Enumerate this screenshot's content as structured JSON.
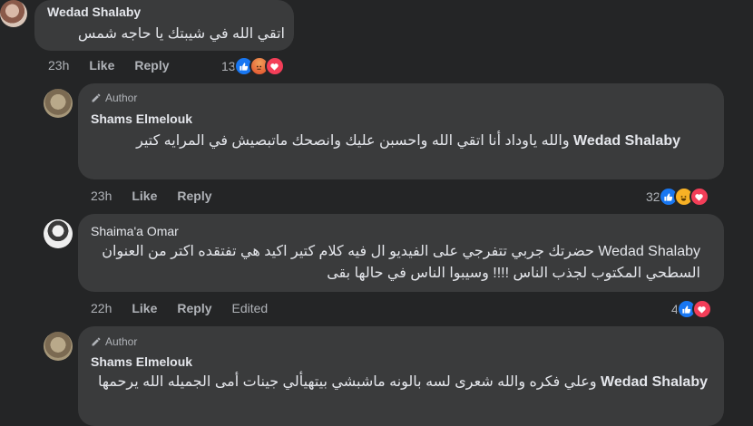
{
  "comments": [
    {
      "author": "Wedad Shalaby",
      "text": "اتقي الله في شيبتك يا حاجه شمس",
      "time": "23h",
      "like_label": "Like",
      "reply_label": "Reply",
      "reaction_count": "13"
    },
    {
      "author_badge": "Author",
      "author": "Shams Elmelouk",
      "mention": "Wedad Shalaby",
      "text": "والله ياوداد أنا اتقي الله واحسبن عليك وانصحك ماتبصيش في المرايه كتير",
      "time": "23h",
      "like_label": "Like",
      "reply_label": "Reply",
      "reaction_count": "32"
    },
    {
      "author": "Shaima'a Omar",
      "mention": "Wedad Shalaby",
      "text": "حضرتك جربي تتفرجي على الفيديو ال فيه كلام كتير اكيد هي تفتقده اكتر من العنوان السطحي المكتوب لجذب الناس !!!! وسيبوا الناس في حالها بقى",
      "time": "22h",
      "like_label": "Like",
      "reply_label": "Reply",
      "edited_label": "Edited",
      "reaction_count": "4"
    },
    {
      "author_badge": "Author",
      "author": "Shams Elmelouk",
      "mention": "Wedad Shalaby",
      "text": "وعلي فكره والله شعرى لسه بالونه ماشبشي بيتهيألي جينات أمى الجميله الله يرحمها"
    }
  ],
  "colors": {
    "background": "#242526",
    "bubble": "#3a3b3c",
    "text": "#e4e6eb",
    "muted": "#b0b3b8",
    "like": "#1877f2",
    "love": "#f33e58"
  },
  "icons": [
    "like-reaction-icon",
    "angry-reaction-icon",
    "love-reaction-icon",
    "haha-reaction-icon",
    "pencil-icon"
  ]
}
